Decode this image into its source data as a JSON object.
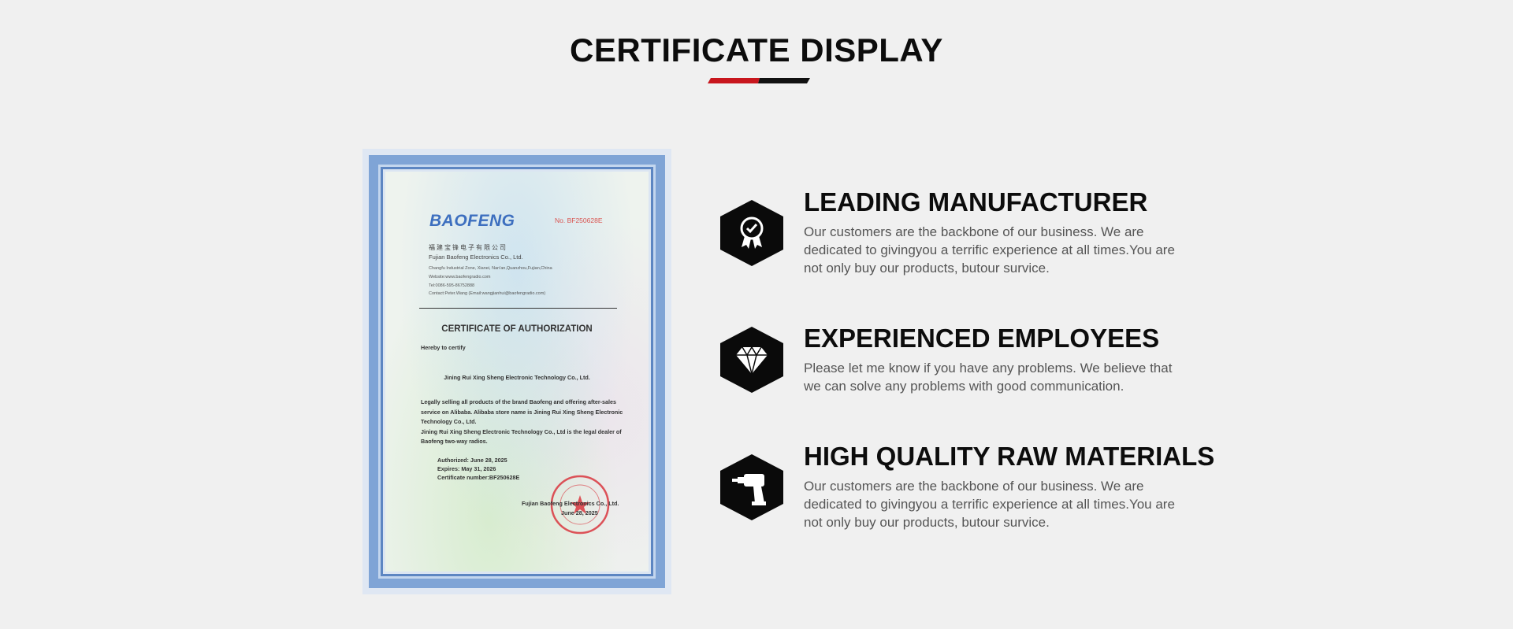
{
  "section": {
    "title": "CERTIFICATE DISPLAY",
    "accent_color": "#c8161d",
    "dark_color": "#111111"
  },
  "certificate": {
    "logo": "BAOFENG",
    "number": "No. BF250628E",
    "company_cn": "福建宝锋电子有限公司",
    "company_en": "Fujian Baofeng Electronics Co., Ltd.",
    "address": "Changfu Industrial Zone, Xianei, Nan'an,Quanzhou,Fujian,China",
    "website": "Website:www.baofengradio.com",
    "tel": "Tel:0086-595-86752888",
    "contact": "Contact:Peter.Wang (Email:wangjianhui@baofengradio.com)",
    "heading": "CERTIFICATE OF AUTHORIZATION",
    "certify": "Hereby to certify",
    "dealer": "Jining Rui Xing Sheng Electronic Technology Co., Ltd.",
    "para_lines": [
      "Legally selling all products of the brand Baofeng and offering after-sales",
      "service on Alibaba. Alibaba store name is Jining Rui Xing Sheng Electronic",
      "Technology Co., Ltd.",
      "Jining Rui Xing Sheng Electronic Technology Co., Ltd is the legal dealer of",
      "Baofeng two-way radios."
    ],
    "authorized": "Authorized: June 28, 2025",
    "expires": "Expires: May 31, 2026",
    "cert_number": "Certificate number:BF250628E",
    "signer": "Fujian Baofeng Electronics Co., Ltd.",
    "sign_date": "June 28, 2025",
    "seal_color": "#d9363e"
  },
  "features": [
    {
      "icon": "award-badge-icon",
      "title": "LEADING MANUFACTURER",
      "lines": [
        "Our customers are the backbone of our business. We are",
        "dedicated to givingyou a terrific experience at all times.You are",
        "not only buy our products, butour survice."
      ]
    },
    {
      "icon": "diamond-icon",
      "title": "EXPERIENCED EMPLOYEES",
      "lines": [
        "Please let me know if you have any problems. We believe that",
        "we can solve any problems with good communication."
      ]
    },
    {
      "icon": "drill-icon",
      "title": "HIGH QUALITY RAW MATERIALS",
      "lines": [
        "Our customers are the backbone of our business. We are",
        "dedicated to givingyou a terrific experience at all times.You are",
        "not only buy our products, butour survice."
      ]
    }
  ]
}
